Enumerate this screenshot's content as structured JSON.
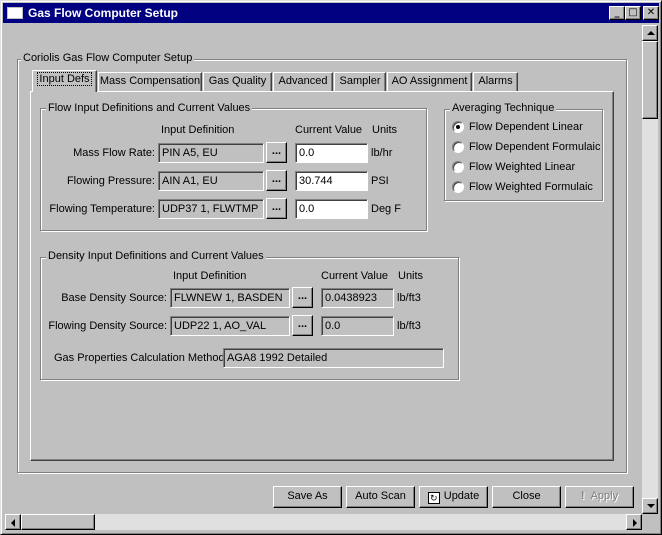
{
  "window": {
    "title": "Gas Flow Computer Setup",
    "controls": {
      "minimize": "_",
      "maximize": "□",
      "close": "✕"
    }
  },
  "outer_group": {
    "legend": "Coriolis Gas Flow Computer Setup"
  },
  "tabs": [
    {
      "label": "Input Defs",
      "active": true
    },
    {
      "label": "Mass Compensation"
    },
    {
      "label": "Gas Quality"
    },
    {
      "label": "Advanced"
    },
    {
      "label": "Sampler"
    },
    {
      "label": "AO Assignment"
    },
    {
      "label": "Alarms"
    }
  ],
  "flow_group": {
    "legend": "Flow Input Definitions and Current Values",
    "col_input_def": "Input Definition",
    "col_current_value": "Current Value",
    "col_units": "Units",
    "rows": [
      {
        "label": "Mass Flow Rate:",
        "definition": "PIN A5, EU",
        "value": "0.0",
        "units": "lb/hr"
      },
      {
        "label": "Flowing Pressure:",
        "definition": "AIN A1, EU",
        "value": "30.744",
        "units": "PSI"
      },
      {
        "label": "Flowing Temperature:",
        "definition": "UDP37 1, FLWTMP",
        "value": "0.0",
        "units": "Deg F"
      }
    ],
    "browse_label": "..."
  },
  "averaging": {
    "legend": "Averaging Technique",
    "options": [
      {
        "label": "Flow Dependent Linear",
        "checked": true
      },
      {
        "label": "Flow Dependent Formulaic",
        "checked": false
      },
      {
        "label": "Flow Weighted Linear",
        "checked": false
      },
      {
        "label": "Flow Weighted Formulaic",
        "checked": false
      }
    ]
  },
  "density_group": {
    "legend": "Density Input Definitions and Current Values",
    "col_input_def": "Input Definition",
    "col_current_value": "Current Value",
    "col_units": "Units",
    "rows": [
      {
        "label": "Base Density Source:",
        "definition": "FLWNEW 1, BASDEN",
        "value": "0.0438923",
        "units": "lb/ft3"
      },
      {
        "label": "Flowing Density Source:",
        "definition": "UDP22 1, AO_VAL",
        "value": "0.0",
        "units": "lb/ft3"
      }
    ],
    "browse_label": "...",
    "gas_props_label": "Gas Properties Calculation Method:",
    "gas_props_value": "AGA8 1992 Detailed"
  },
  "buttons": {
    "save_as": "Save As",
    "auto_scan": "Auto Scan",
    "update": "Update",
    "close": "Close",
    "apply": "Apply"
  },
  "icons": {
    "update": "refresh-icon",
    "apply": "exclamation-icon"
  }
}
